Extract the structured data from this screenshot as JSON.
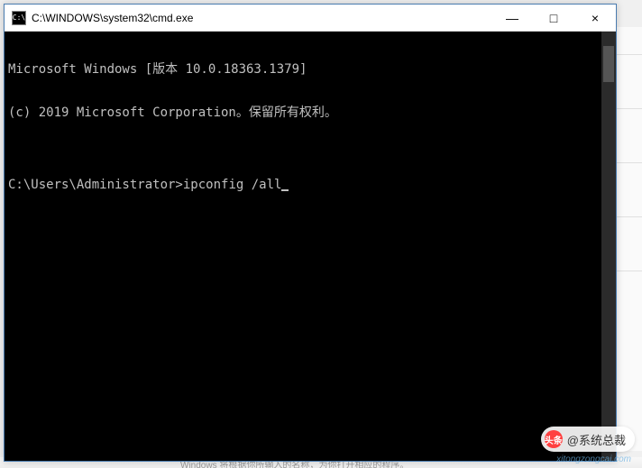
{
  "window": {
    "title": "C:\\WINDOWS\\system32\\cmd.exe",
    "icon_label": "C:\\"
  },
  "titlebar_buttons": {
    "minimize": "—",
    "maximize": "□",
    "close": "×"
  },
  "terminal": {
    "line1": "Microsoft Windows [版本 10.0.18363.1379]",
    "line2": "(c) 2019 Microsoft Corporation。保留所有权利。",
    "blank": "",
    "prompt": "C:\\Users\\Administrator>",
    "command": "ipconfig /all"
  },
  "watermark": {
    "logo_text": "头条",
    "badge_text": "@系统总裁",
    "sub_text": "xitongzongcai.com"
  },
  "background": {
    "bottom_text": "Windows 将根据你所输入的名称，为你打开相应的程序。"
  }
}
